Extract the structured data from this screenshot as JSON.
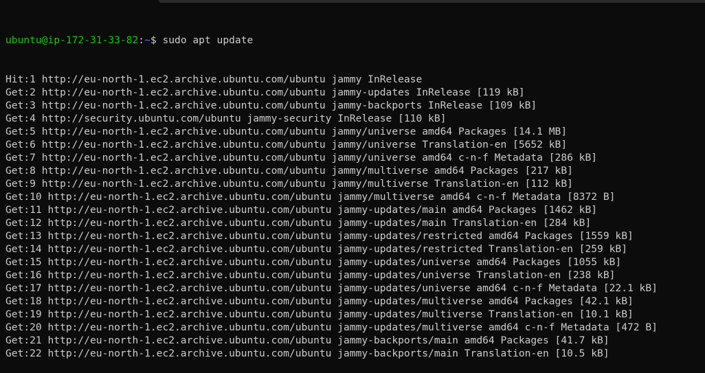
{
  "prompt": {
    "user_host": "ubuntu@ip-172-31-33-82",
    "sep": ":",
    "path": "~",
    "symbol": "$ ",
    "command": "sudo apt update"
  },
  "output": [
    "Hit:1 http://eu-north-1.ec2.archive.ubuntu.com/ubuntu jammy InRelease",
    "Get:2 http://eu-north-1.ec2.archive.ubuntu.com/ubuntu jammy-updates InRelease [119 kB]",
    "Get:3 http://eu-north-1.ec2.archive.ubuntu.com/ubuntu jammy-backports InRelease [109 kB]",
    "Get:4 http://security.ubuntu.com/ubuntu jammy-security InRelease [110 kB]",
    "Get:5 http://eu-north-1.ec2.archive.ubuntu.com/ubuntu jammy/universe amd64 Packages [14.1 MB]",
    "Get:6 http://eu-north-1.ec2.archive.ubuntu.com/ubuntu jammy/universe Translation-en [5652 kB]",
    "Get:7 http://eu-north-1.ec2.archive.ubuntu.com/ubuntu jammy/universe amd64 c-n-f Metadata [286 kB]",
    "Get:8 http://eu-north-1.ec2.archive.ubuntu.com/ubuntu jammy/multiverse amd64 Packages [217 kB]",
    "Get:9 http://eu-north-1.ec2.archive.ubuntu.com/ubuntu jammy/multiverse Translation-en [112 kB]",
    "Get:10 http://eu-north-1.ec2.archive.ubuntu.com/ubuntu jammy/multiverse amd64 c-n-f Metadata [8372 B]",
    "Get:11 http://eu-north-1.ec2.archive.ubuntu.com/ubuntu jammy-updates/main amd64 Packages [1462 kB]",
    "Get:12 http://eu-north-1.ec2.archive.ubuntu.com/ubuntu jammy-updates/main Translation-en [284 kB]",
    "Get:13 http://eu-north-1.ec2.archive.ubuntu.com/ubuntu jammy-updates/restricted amd64 Packages [1559 kB]",
    "Get:14 http://eu-north-1.ec2.archive.ubuntu.com/ubuntu jammy-updates/restricted Translation-en [259 kB]",
    "Get:15 http://eu-north-1.ec2.archive.ubuntu.com/ubuntu jammy-updates/universe amd64 Packages [1055 kB]",
    "Get:16 http://eu-north-1.ec2.archive.ubuntu.com/ubuntu jammy-updates/universe Translation-en [238 kB]",
    "Get:17 http://eu-north-1.ec2.archive.ubuntu.com/ubuntu jammy-updates/universe amd64 c-n-f Metadata [22.1 kB]",
    "Get:18 http://eu-north-1.ec2.archive.ubuntu.com/ubuntu jammy-updates/multiverse amd64 Packages [42.1 kB]",
    "Get:19 http://eu-north-1.ec2.archive.ubuntu.com/ubuntu jammy-updates/multiverse Translation-en [10.1 kB]",
    "Get:20 http://eu-north-1.ec2.archive.ubuntu.com/ubuntu jammy-updates/multiverse amd64 c-n-f Metadata [472 B]",
    "Get:21 http://eu-north-1.ec2.archive.ubuntu.com/ubuntu jammy-backports/main amd64 Packages [41.7 kB]",
    "Get:22 http://eu-north-1.ec2.archive.ubuntu.com/ubuntu jammy-backports/main Translation-en [10.5 kB]"
  ],
  "colors": {
    "background": "#0c0c0c",
    "text": "#cccccc",
    "user": "#16c60c",
    "path": "#3b78ff"
  }
}
